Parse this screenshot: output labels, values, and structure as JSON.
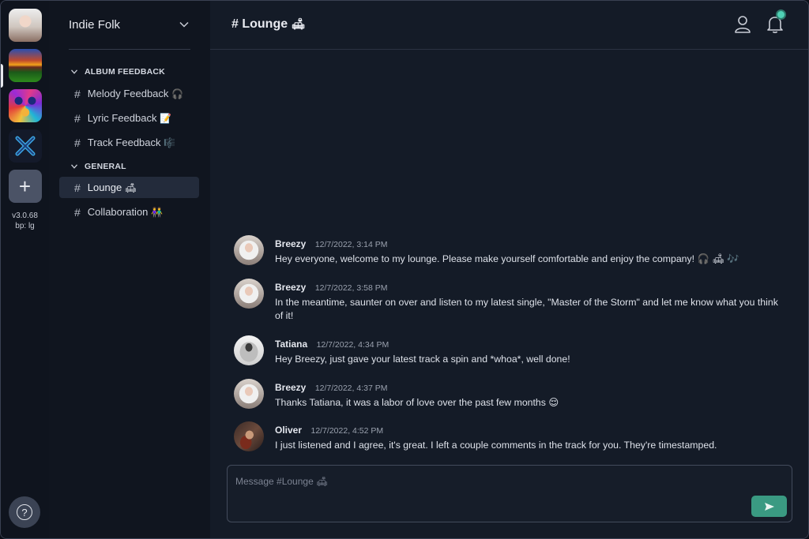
{
  "rail": {
    "version": "v3.0.68",
    "breakpoint": "bp: lg",
    "add_label": "+",
    "help_label": "?"
  },
  "sidebar": {
    "server_name": "Indie Folk",
    "categories": [
      {
        "label": "ALBUM FEEDBACK",
        "channels": [
          {
            "name": "Melody Feedback",
            "emoji": "🎧"
          },
          {
            "name": "Lyric Feedback",
            "emoji": "📝"
          },
          {
            "name": "Track Feedback",
            "emoji": "🎼"
          }
        ]
      },
      {
        "label": "GENERAL",
        "channels": [
          {
            "name": "Lounge",
            "emoji": "🛋"
          },
          {
            "name": "Collaboration",
            "emoji": "👫"
          }
        ]
      }
    ],
    "hash": "#"
  },
  "header": {
    "title": "# Lounge",
    "title_emoji": "🛋"
  },
  "messages": [
    {
      "author": "Breezy",
      "time": "12/7/2022, 3:14 PM",
      "text": "Hey everyone, welcome to my lounge. Please make yourself comfortable and enjoy the company! 🎧 🛋 🎶"
    },
    {
      "author": "Breezy",
      "time": "12/7/2022, 3:58 PM",
      "text": "In the meantime, saunter on over and listen to my latest single, \"Master of the Storm\" and let me know what you think of it!"
    },
    {
      "author": "Tatiana",
      "time": "12/7/2022, 4:34 PM",
      "text": "Hey Breezy, just gave your latest track a spin and *whoa*, well done!"
    },
    {
      "author": "Breezy",
      "time": "12/7/2022, 4:37 PM",
      "text": "Thanks Tatiana, it was a labor of love over the past few months 😌"
    },
    {
      "author": "Oliver",
      "time": "12/7/2022, 4:52 PM",
      "text": "I just listened and I agree, it's great. I left a couple comments in the track for you. They're timestamped."
    }
  ],
  "composer": {
    "placeholder": "Message #Lounge 🛋"
  },
  "colors": {
    "accent": "#3a9a82",
    "notification_dot": "#4fd1b5"
  }
}
